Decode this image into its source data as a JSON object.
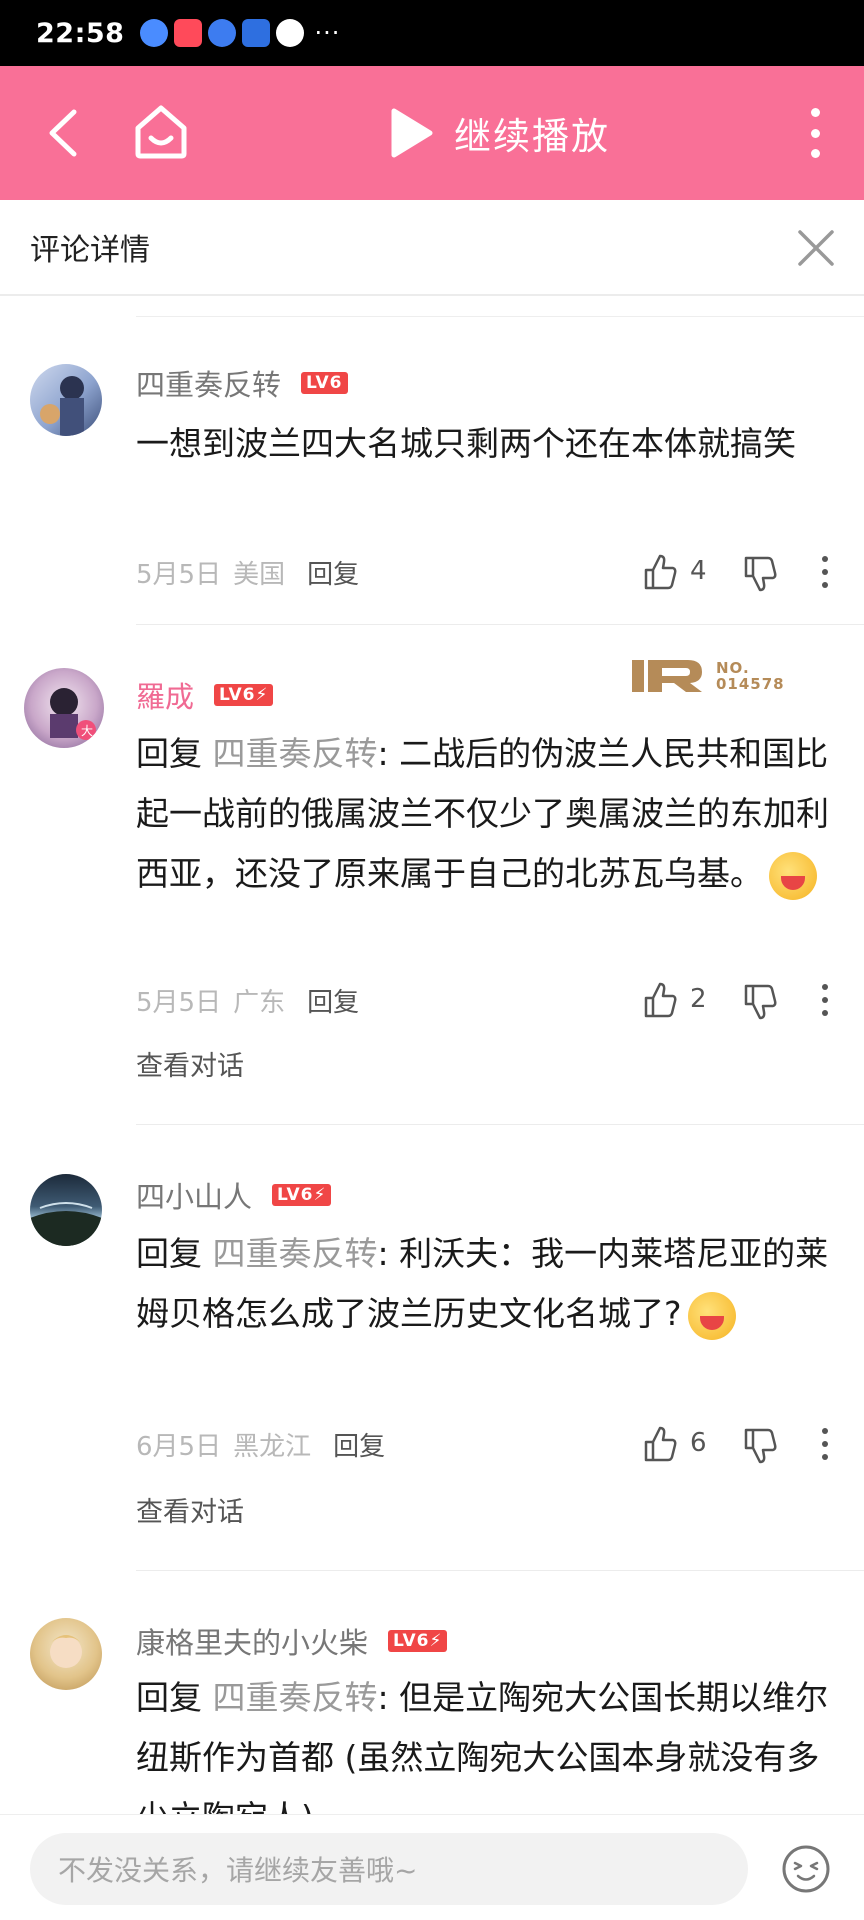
{
  "status_bar": {
    "time": "22:58",
    "more": "···"
  },
  "top_bar": {
    "continue_label": "继续播放",
    "accent_color": "#f97097"
  },
  "detail": {
    "title": "评论详情"
  },
  "comments": [
    {
      "username": "四重奏反转",
      "level": "LV6",
      "text": "一想到波兰四大名城只剩两个还在本体就搞笑",
      "date": "5月5日",
      "location": "美国",
      "reply_label": "回复",
      "likes": "4"
    },
    {
      "username": "羅成",
      "level": "LV6⚡",
      "reply_prefix": "回复 ",
      "reply_target": "四重奏反转",
      "text": ": 二战后的伪波兰人民共和国比起一战前的俄属波兰不仅少了奥属波兰的东加利西亚，还没了原来属于自己的北苏瓦乌基。",
      "date": "5月5日",
      "location": "广东",
      "reply_label": "回复",
      "likes": "2",
      "view_conversation": "查看对话",
      "badge_no": "NO.",
      "badge_num": "014578"
    },
    {
      "username": "四小山人",
      "level": "LV6⚡",
      "reply_prefix": "回复 ",
      "reply_target": "四重奏反转",
      "text": ": 利沃夫：我一内莱塔尼亚的莱姆贝格怎么成了波兰历史文化名城了?",
      "date": "6月5日",
      "location": "黑龙江",
      "reply_label": "回复",
      "likes": "6",
      "view_conversation": "查看对话"
    },
    {
      "username": "康格里夫的小火柴",
      "level": "LV6⚡",
      "reply_prefix": "回复 ",
      "reply_target": "四重奏反转",
      "text": ": 但是立陶宛大公国长期以维尔纽斯作为首都 (虽然立陶宛大公国本身就没有多少立陶宛人)"
    }
  ],
  "input": {
    "placeholder": "不发没关系，请继续友善哦~"
  }
}
